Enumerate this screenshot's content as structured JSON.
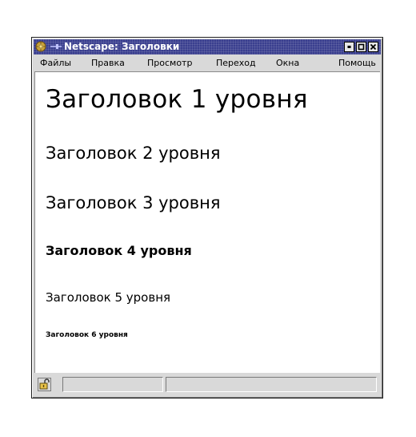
{
  "window": {
    "title": "Netscape: Заголовки",
    "title_icon": "netscape-compass-icon",
    "pin_icon": "pin-icon",
    "controls": [
      "minimize-icon",
      "maximize-icon",
      "close-icon"
    ]
  },
  "menubar": {
    "items": [
      "Файлы",
      "Правка",
      "Просмотр",
      "Переход",
      "Окна",
      "Помощь"
    ]
  },
  "content": {
    "headings": [
      "Заголовок 1 уровня",
      "Заголовок 2 уровня",
      "Заголовок 3 уровня",
      "Заголовок 4 уровня",
      "Заголовок 5 уровня",
      "Заголовок 6 уровня"
    ]
  },
  "statusbar": {
    "security_icon": "lock-open-icon",
    "status_text": "",
    "progress_text": ""
  },
  "colors": {
    "titlebar": "#3a3f8f",
    "chrome": "#d9d9d9",
    "page_background": "#ffffff"
  }
}
